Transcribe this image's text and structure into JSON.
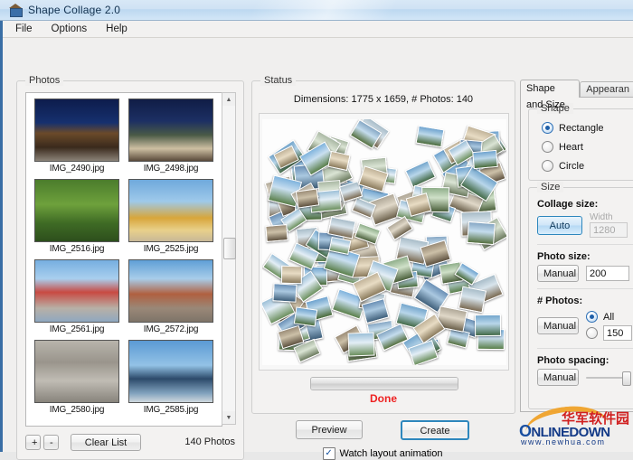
{
  "window": {
    "title": "Shape Collage 2.0",
    "icon": "app-icon"
  },
  "menu": {
    "items": [
      "File",
      "Options",
      "Help"
    ]
  },
  "photos_panel": {
    "title": "Photos",
    "thumbnails": [
      {
        "label": "IMG_2490.jpg",
        "scene": "kremlin-night"
      },
      {
        "label": "IMG_2498.jpg",
        "scene": "st-basils-night"
      },
      {
        "label": "IMG_2516.jpg",
        "scene": "green-trees"
      },
      {
        "label": "IMG_2525.jpg",
        "scene": "golden-domes"
      },
      {
        "label": "IMG_2561.jpg",
        "scene": "metro-sign"
      },
      {
        "label": "IMG_2572.jpg",
        "scene": "st-basils-day"
      },
      {
        "label": "IMG_2580.jpg",
        "scene": "cobblestone"
      },
      {
        "label": "IMG_2585.jpg",
        "scene": "bridge-sky"
      }
    ],
    "add_label": "+",
    "remove_label": "-",
    "clear_label": "Clear List",
    "count_label": "140 Photos"
  },
  "status_panel": {
    "title": "Status",
    "dimensions": "Dimensions: 1775 x 1659, # Photos: 140",
    "progress_percent": 100,
    "done_label": "Done"
  },
  "actions": {
    "preview_label": "Preview",
    "create_label": "Create",
    "watch_label": "Watch layout animation",
    "watch_checked": true,
    "check_glyph": "✓"
  },
  "options_panel": {
    "tabs": [
      {
        "label": "Shape and Size",
        "active": true
      },
      {
        "label": "Appearan",
        "active": false
      }
    ],
    "shape": {
      "title": "Shape",
      "options": [
        {
          "label": "Rectangle",
          "selected": true
        },
        {
          "label": "Heart",
          "selected": false
        },
        {
          "label": "Circle",
          "selected": false
        }
      ],
      "options_col2": [
        {
          "label": "",
          "selected": false
        },
        {
          "label": "",
          "selected": false
        }
      ]
    },
    "size": {
      "title": "Size",
      "collage_size_label": "Collage size:",
      "collage_size_button": "Auto",
      "width_label": "Width",
      "width_value": "1280",
      "photo_size_label": "Photo size:",
      "photo_size_button": "Manual",
      "photo_size_value": "200",
      "num_photos_label": "# Photos:",
      "num_photos_button": "Manual",
      "num_photos_all_label": "All",
      "num_photos_all_selected": true,
      "num_photos_value": "150",
      "photo_spacing_label": "Photo spacing:",
      "photo_spacing_button": "Manual"
    }
  },
  "watermark": {
    "chinese": "华军软件园",
    "brand": "NLINEDOWN",
    "brand_initial": "O",
    "url": "www.newhua.com"
  },
  "colors": {
    "accent": "#2e87bd",
    "done": "#ee2222",
    "titlebar": "#cfe2f4",
    "watermark_blue": "#133a87",
    "watermark_red": "#d02020"
  }
}
